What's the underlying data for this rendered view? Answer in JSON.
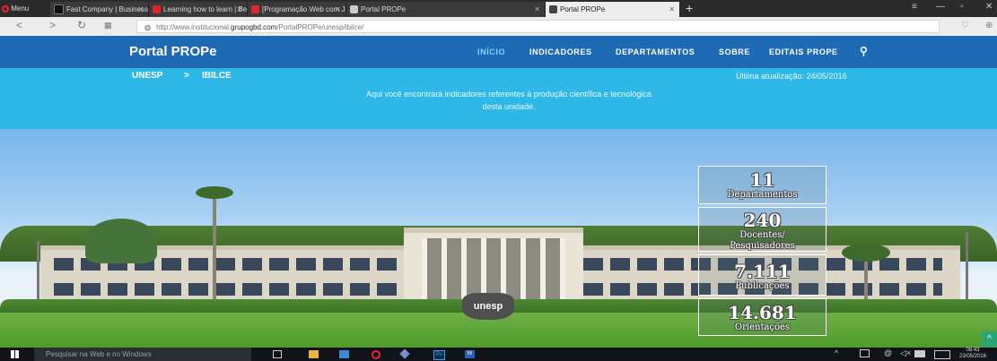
{
  "browser": {
    "menu_label": "Menu",
    "tabs": [
      {
        "title": "Fast Company | Business +",
        "favicon_color": "#111111"
      },
      {
        "title": "Learning how to learn | Be",
        "favicon_color": "#e0262a"
      },
      {
        "title": "[Programação Web com Ja",
        "favicon_color": "#e0262a"
      },
      {
        "title": "Portal PROPe",
        "favicon_color": "#cccccc"
      },
      {
        "title": "Portal PROPe",
        "favicon_color": "#444444"
      }
    ],
    "new_tab_label": "+",
    "url_prefix": "http://www.institucional.",
    "url_domain": "grupogbd.com",
    "url_path": "/PortalPROPe/unesp/ibilce/"
  },
  "site": {
    "brand": "Portal PROPe",
    "nav": [
      {
        "label": "INÍCIO",
        "active": true
      },
      {
        "label": "INDICADORES",
        "active": false
      },
      {
        "label": "DEPARTAMENTOS",
        "active": false
      },
      {
        "label": "SOBRE",
        "active": false
      },
      {
        "label": "EDITAIS PROPE",
        "active": false
      }
    ],
    "search_icon": "search-icon",
    "breadcrumb": [
      "UNESP",
      "IBILCE"
    ],
    "breadcrumb_separator": ">",
    "last_update": "Última atualização: 24/05/2016",
    "intro_line1": "Aqui você encontrará indicadores referentes à produção científica e tecnológica",
    "intro_line2": "desta unidade.",
    "logo_text": "unesp",
    "stats": [
      {
        "value": "11",
        "label": "Departamentos"
      },
      {
        "value": "240",
        "label": "Docentes/ Pesquisadores"
      },
      {
        "value": "7.111",
        "label": "Publicações"
      },
      {
        "value": "14.681",
        "label": "Orientações"
      }
    ]
  },
  "taskbar": {
    "search_placeholder": "Pesquisar na Web e no Windows",
    "time": "08:43",
    "date": "23/05/2016"
  },
  "colors": {
    "nav_bg": "#1e6ab5",
    "subbar_bg": "#2db8e8",
    "active_link": "#7fd3ff"
  }
}
